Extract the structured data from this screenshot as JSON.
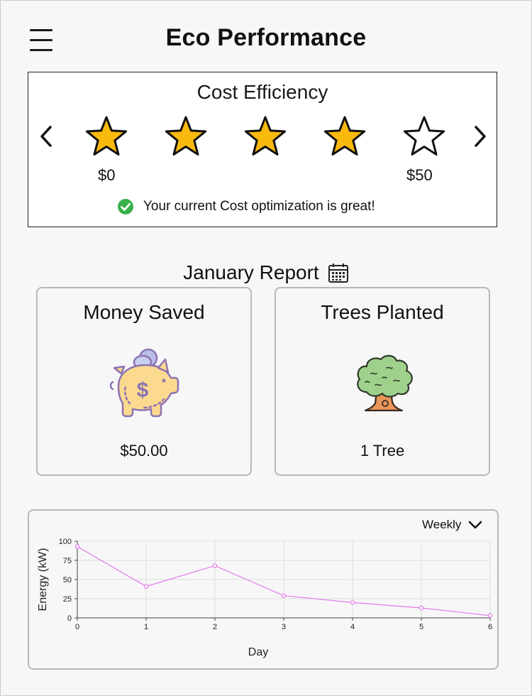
{
  "header": {
    "title": "Eco Performance",
    "menu_icon": "hamburger-menu-icon"
  },
  "cost_efficiency": {
    "title": "Cost Efficiency",
    "rating_filled": 4,
    "rating_max": 5,
    "min_label": "$0",
    "max_label": "$50",
    "status_text": "Your current Cost optimization is great!",
    "status_icon": "check-circle-icon",
    "star_fill_color": "#f9b90d",
    "check_color": "#3ab04a"
  },
  "report": {
    "title": "January Report",
    "calendar_icon": "calendar-icon",
    "cards": [
      {
        "title": "Money Saved",
        "value": "$50.00",
        "icon": "piggy-bank-icon"
      },
      {
        "title": "Trees Planted",
        "value": "1 Tree",
        "icon": "tree-icon"
      }
    ]
  },
  "energy_chart": {
    "period_label": "Weekly",
    "dropdown_icon": "chevron-down-icon"
  },
  "chart_data": {
    "type": "line",
    "x": [
      0,
      1,
      2,
      3,
      4,
      5,
      6
    ],
    "x_ticks": [
      "0",
      "1",
      "2",
      "3",
      "4",
      "5",
      "6"
    ],
    "y_ticks": [
      "0",
      "25",
      "50",
      "75",
      "100"
    ],
    "series": [
      {
        "values": [
          93,
          41,
          68,
          29,
          20,
          13,
          3
        ],
        "color": "#e07ae8"
      }
    ],
    "xlabel": "Day",
    "ylabel": "Energy (kW)",
    "xlim": [
      0,
      6
    ],
    "ylim": [
      0,
      100
    ],
    "grid": true
  }
}
